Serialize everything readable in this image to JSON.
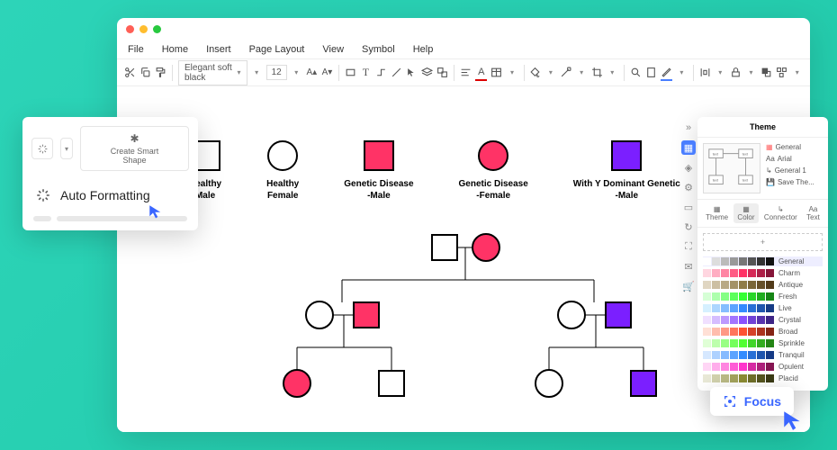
{
  "menu": {
    "file": "File",
    "home": "Home",
    "insert": "Insert",
    "page_layout": "Page Layout",
    "view": "View",
    "symbol": "Symbol",
    "help": "Help"
  },
  "toolbar": {
    "font": "Elegant soft black",
    "size": "12"
  },
  "legend": [
    {
      "label": "Healthy\nMale"
    },
    {
      "label": "Healthy\nFemale"
    },
    {
      "label": "Genetic Disease\n-Male"
    },
    {
      "label": "Genetic Disease\n-Female"
    },
    {
      "label": "With Y Dominant Genetic\n-Male"
    }
  ],
  "autofmt": {
    "create_smart_shape": "Create Smart\nShape",
    "auto_formatting": "Auto Formatting"
  },
  "theme": {
    "title": "Theme",
    "list": {
      "general": "General",
      "arial": "Arial",
      "general1": "General 1",
      "save": "Save The..."
    },
    "tabs": {
      "theme": "Theme",
      "color": "Color",
      "connector": "Connector",
      "text": "Text"
    },
    "swatch_names": [
      "General",
      "Charm",
      "Antique",
      "Fresh",
      "Live",
      "Crystal",
      "Broad",
      "Sprinkle",
      "Tranquil",
      "Opulent",
      "Placid"
    ]
  },
  "focus": {
    "label": "Focus"
  },
  "colors": {
    "pink": "#ff3366",
    "purple": "#7b1fff",
    "accent": "#3a66ff"
  },
  "swatch_rows": [
    [
      "#fff",
      "#ddd",
      "#bbb",
      "#999",
      "#777",
      "#555",
      "#333",
      "#111"
    ],
    [
      "#ffd6e0",
      "#ffadc2",
      "#ff85a3",
      "#ff5c85",
      "#ff3366",
      "#d62957",
      "#ad1f47",
      "#851538"
    ],
    [
      "#e0d6c2",
      "#ccbfa3",
      "#b8a985",
      "#a39266",
      "#8f7c47",
      "#7a6638",
      "#665029",
      "#523b1a"
    ],
    [
      "#d6ffd6",
      "#adffad",
      "#85ff85",
      "#5cff5c",
      "#33ff33",
      "#29d629",
      "#1fad1f",
      "#158515"
    ],
    [
      "#d6f0ff",
      "#add6ff",
      "#85bdff",
      "#5ca3ff",
      "#338aff",
      "#296fd6",
      "#1f55ad",
      "#153b85"
    ],
    [
      "#f0e0ff",
      "#d6bdff",
      "#bd99ff",
      "#a375ff",
      "#8a52ff",
      "#7042d6",
      "#5733ad",
      "#3d2485"
    ],
    [
      "#ffe0d6",
      "#ffbdad",
      "#ff9985",
      "#ff755c",
      "#ff5233",
      "#d64229",
      "#ad331f",
      "#852415"
    ],
    [
      "#e0ffd6",
      "#bdffad",
      "#99ff85",
      "#75ff5c",
      "#52ff33",
      "#42d629",
      "#33ad1f",
      "#248515"
    ],
    [
      "#d6e8ff",
      "#add1ff",
      "#85baff",
      "#5ca3ff",
      "#338cff",
      "#2970d6",
      "#1f55ad",
      "#153a85"
    ],
    [
      "#ffd6f5",
      "#ffadeb",
      "#ff85e0",
      "#ff5cd6",
      "#ff33cc",
      "#d629a3",
      "#ad1f7a",
      "#851552"
    ],
    [
      "#e8e8d6",
      "#d1d1ad",
      "#baba85",
      "#a3a35c",
      "#8c8c33",
      "#707029",
      "#55551f",
      "#3a3a15"
    ]
  ]
}
